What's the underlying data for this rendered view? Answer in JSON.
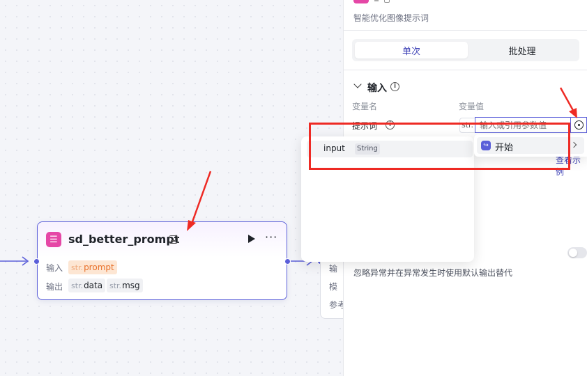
{
  "node": {
    "title": "sd_better_prompt",
    "icon": "node-settings-icon",
    "input_label": "输入",
    "output_label": "输出",
    "inputs": [
      {
        "type": "str.",
        "name": "prompt"
      }
    ],
    "outputs": [
      {
        "type": "str.",
        "name": "data"
      },
      {
        "type": "str.",
        "name": "msg"
      }
    ],
    "more": "···"
  },
  "node2": {
    "rows": [
      "输",
      "模",
      "参考"
    ]
  },
  "panel": {
    "description": "智能优化图像提示词",
    "tabs": [
      {
        "label": "单次",
        "active": true
      },
      {
        "label": "批处理",
        "active": false
      }
    ],
    "section_title": "输入",
    "col_name": "变量名",
    "col_value": "变量值",
    "param": {
      "name": "提示词",
      "type": "str.",
      "placeholder": "输入或引用参数值"
    },
    "example_link": "查看示例",
    "note": "忽略异常并在异常发生时使用默认输出替代",
    "toggle_on": false
  },
  "dropdown": {
    "left_items": [
      {
        "name": "input",
        "type": "String"
      }
    ],
    "right_items": [
      {
        "label": "开始",
        "icon": "start-node-icon"
      }
    ]
  },
  "colors": {
    "accent": "#5b5fd9",
    "node_icon": "#e547a6",
    "annotation": "#ee2a24",
    "input_tag": "#fde6d3"
  }
}
